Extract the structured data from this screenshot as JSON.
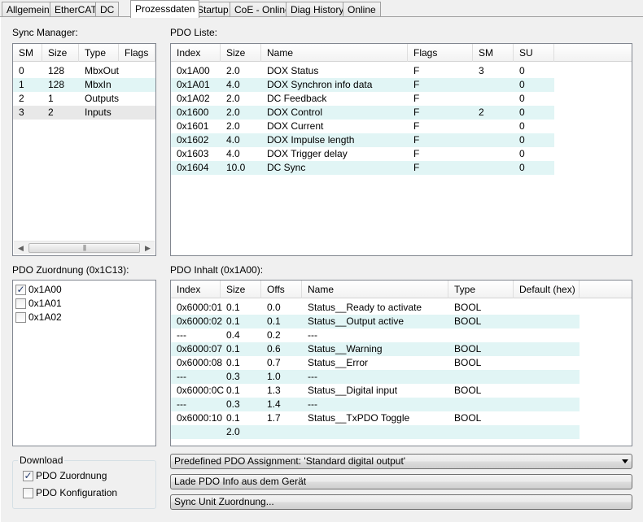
{
  "tabs": [
    {
      "label": "Allgemein"
    },
    {
      "label": "EtherCAT"
    },
    {
      "label": "DC"
    },
    {
      "label": "Prozessdaten"
    },
    {
      "label": "Startup"
    },
    {
      "label": "CoE - Online"
    },
    {
      "label": "Diag History"
    },
    {
      "label": "Online"
    }
  ],
  "active_tab": "Prozessdaten",
  "sync_manager": {
    "label": "Sync Manager:",
    "columns": [
      "SM",
      "Size",
      "Type",
      "Flags"
    ],
    "rows": [
      {
        "sm": "0",
        "size": "128",
        "type": "MbxOut",
        "flags": ""
      },
      {
        "sm": "1",
        "size": "128",
        "type": "MbxIn",
        "flags": ""
      },
      {
        "sm": "2",
        "size": "1",
        "type": "Outputs",
        "flags": ""
      },
      {
        "sm": "3",
        "size": "2",
        "type": "Inputs",
        "flags": ""
      }
    ]
  },
  "pdo_list": {
    "label": "PDO Liste:",
    "columns": [
      "Index",
      "Size",
      "Name",
      "Flags",
      "SM",
      "SU"
    ],
    "rows": [
      {
        "index": "0x1A00",
        "size": "2.0",
        "name": "DOX Status",
        "flags": "F",
        "sm": "3",
        "su": "0"
      },
      {
        "index": "0x1A01",
        "size": "4.0",
        "name": "DOX Synchron info data",
        "flags": "F",
        "sm": "",
        "su": "0"
      },
      {
        "index": "0x1A02",
        "size": "2.0",
        "name": "DC Feedback",
        "flags": "F",
        "sm": "",
        "su": "0"
      },
      {
        "index": "0x1600",
        "size": "2.0",
        "name": "DOX Control",
        "flags": "F",
        "sm": "2",
        "su": "0"
      },
      {
        "index": "0x1601",
        "size": "2.0",
        "name": "DOX Current",
        "flags": "F",
        "sm": "",
        "su": "0"
      },
      {
        "index": "0x1602",
        "size": "4.0",
        "name": "DOX Impulse length",
        "flags": "F",
        "sm": "",
        "su": "0"
      },
      {
        "index": "0x1603",
        "size": "4.0",
        "name": "DOX Trigger delay",
        "flags": "F",
        "sm": "",
        "su": "0"
      },
      {
        "index": "0x1604",
        "size": "10.0",
        "name": "DC Sync",
        "flags": "F",
        "sm": "",
        "su": "0"
      }
    ]
  },
  "pdo_assignment": {
    "label": "PDO Zuordnung (0x1C13):",
    "items": [
      {
        "label": "0x1A00",
        "checked": true
      },
      {
        "label": "0x1A01",
        "checked": false
      },
      {
        "label": "0x1A02",
        "checked": false
      }
    ]
  },
  "pdo_content": {
    "label": "PDO Inhalt (0x1A00):",
    "columns": [
      "Index",
      "Size",
      "Offs",
      "Name",
      "Type",
      "Default (hex)"
    ],
    "rows": [
      {
        "index": "0x6000:01",
        "size": "0.1",
        "offs": "0.0",
        "name": "Status__Ready to activate",
        "type": "BOOL",
        "default": ""
      },
      {
        "index": "0x6000:02",
        "size": "0.1",
        "offs": "0.1",
        "name": "Status__Output active",
        "type": "BOOL",
        "default": ""
      },
      {
        "index": "---",
        "size": "0.4",
        "offs": "0.2",
        "name": "---",
        "type": "",
        "default": ""
      },
      {
        "index": "0x6000:07",
        "size": "0.1",
        "offs": "0.6",
        "name": "Status__Warning",
        "type": "BOOL",
        "default": ""
      },
      {
        "index": "0x6000:08",
        "size": "0.1",
        "offs": "0.7",
        "name": "Status__Error",
        "type": "BOOL",
        "default": ""
      },
      {
        "index": "---",
        "size": "0.3",
        "offs": "1.0",
        "name": "---",
        "type": "",
        "default": ""
      },
      {
        "index": "0x6000:0C",
        "size": "0.1",
        "offs": "1.3",
        "name": "Status__Digital input",
        "type": "BOOL",
        "default": ""
      },
      {
        "index": "---",
        "size": "0.3",
        "offs": "1.4",
        "name": "---",
        "type": "",
        "default": ""
      },
      {
        "index": "0x6000:10",
        "size": "0.1",
        "offs": "1.7",
        "name": "Status__TxPDO Toggle",
        "type": "BOOL",
        "default": ""
      },
      {
        "index": "",
        "size": "2.0",
        "offs": "",
        "name": "",
        "type": "",
        "default": ""
      }
    ]
  },
  "download": {
    "label": "Download",
    "options": [
      {
        "label": "PDO Zuordnung",
        "checked": true
      },
      {
        "label": "PDO Konfiguration",
        "checked": false
      }
    ]
  },
  "buttons": {
    "predefined": "Predefined PDO Assignment: 'Standard digital output'",
    "load": "Lade PDO Info aus dem Gerät",
    "sync_unit": "Sync Unit Zuordnung..."
  },
  "colors": {
    "alt_row": "#e1f5f5",
    "border": "#828790"
  }
}
